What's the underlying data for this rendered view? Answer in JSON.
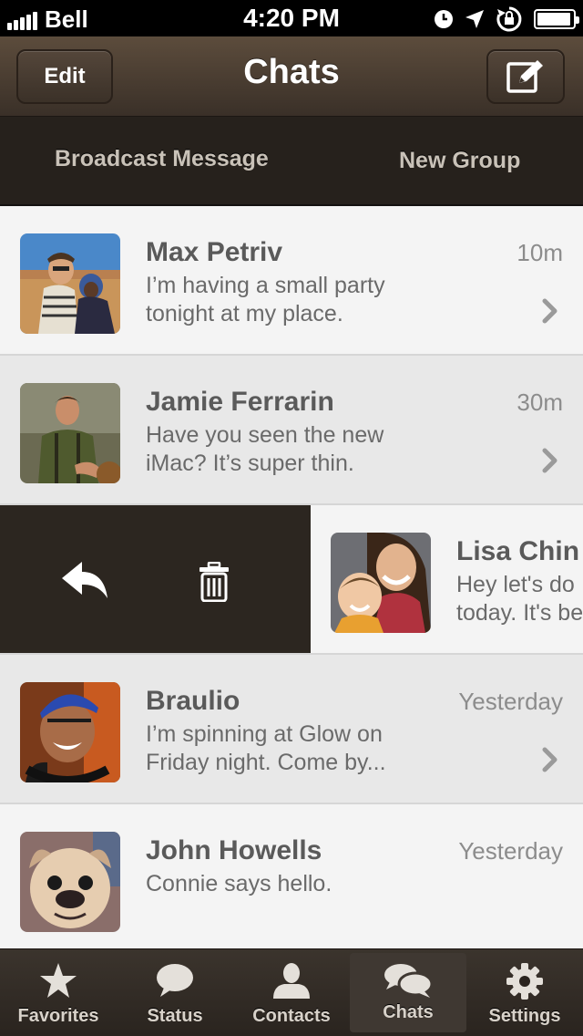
{
  "status_bar": {
    "carrier": "Bell",
    "time": "4:20 PM",
    "battery_level": 0.95
  },
  "nav": {
    "edit_label": "Edit",
    "title": "Chats",
    "compose_icon": "compose-icon"
  },
  "actions": {
    "broadcast_label": "Broadcast Message",
    "new_group_label": "New Group"
  },
  "chats": [
    {
      "name": "Max Petriv",
      "preview": "I’m having a small party\ntonight at my place.",
      "time": "10m"
    },
    {
      "name": "Jamie Ferrarin",
      "preview": "Have you seen the new\niMac? It’s super thin.",
      "time": "30m"
    },
    {
      "name": "Lisa Chin",
      "preview": "Hey let's do\ntoday. It's be",
      "time": ""
    },
    {
      "name": "Braulio",
      "preview": "I’m spinning at Glow on\nFriday night. Come by...",
      "time": "Yesterday"
    },
    {
      "name": "John Howells",
      "preview": "Connie says hello.",
      "time": "Yesterday"
    }
  ],
  "swipe_actions": {
    "reply_icon": "reply-icon",
    "delete_icon": "trash-icon"
  },
  "tabs": [
    {
      "label": "Favorites",
      "icon": "star-icon"
    },
    {
      "label": "Status",
      "icon": "speech-bubble-icon"
    },
    {
      "label": "Contacts",
      "icon": "person-icon"
    },
    {
      "label": "Chats",
      "icon": "chat-bubbles-icon",
      "active": true
    },
    {
      "label": "Settings",
      "icon": "gear-icon"
    }
  ],
  "colors": {
    "nav_brown": "#4a3d31",
    "strip_dark": "#26211c",
    "row_light": "#f4f4f4",
    "row_dark": "#e8e8e8"
  }
}
